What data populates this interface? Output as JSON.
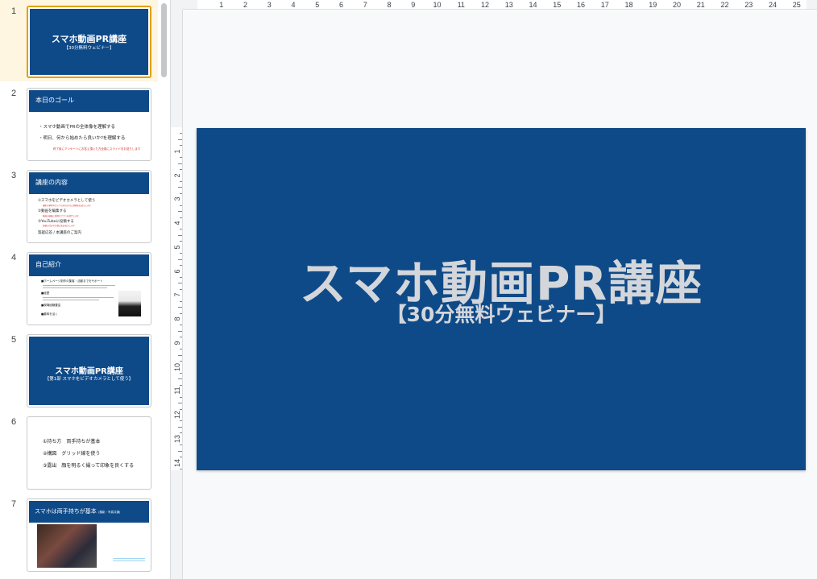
{
  "filmstrip": {
    "slides": [
      {
        "num": "1",
        "title": "スマホ動画PR講座",
        "subtitle": "【30分無料ウェビナー】"
      },
      {
        "num": "2",
        "header": "本日のゴール",
        "lines": [
          "・スマホ動画でPRの全体像を理解する",
          "・明日、何から始めたら良いか?を理解する"
        ],
        "note": "終了後にアンケートにお答え頂いた方全員にスライドをお送りします"
      },
      {
        "num": "3",
        "header": "講座の内容",
        "lines": [
          "①スマホをビデオカメラとして使う",
          "②動画を編集する",
          "③YouTubeに投稿する",
          "質疑応答 / 本講座のご案内"
        ],
        "notes": [
          "撮影の基本やカメラの持ち方など基礎をお伝えします",
          "動画の編集に便利なアプリを紹介します",
          "投稿の仕方や注意点をお伝えします"
        ]
      },
      {
        "num": "4",
        "header": "自己紹介",
        "lines": [
          "■ホームページ制作の集客・活動までをサポート",
          "■経歴",
          "■現場経験豊富",
          "■趣味を活く"
        ]
      },
      {
        "num": "5",
        "title": "スマホ動画PR講座",
        "subtitle": "【第1部 スマホをビデオカメラとして使う】"
      },
      {
        "num": "6",
        "lines": [
          "①持ち方　両手持ちが基本",
          "②構図　グリッド線を使う",
          "③露出　顔を明るく撮って印象を良くする"
        ]
      },
      {
        "num": "7",
        "header": "スマホは両手持ちが基本",
        "header_small": "(撮影・写真共通)"
      }
    ]
  },
  "ruler": {
    "horizontal": [
      "1",
      "2",
      "3",
      "4",
      "5",
      "6",
      "7",
      "8",
      "9",
      "10",
      "11",
      "12",
      "13",
      "14",
      "15",
      "16",
      "17",
      "18",
      "19",
      "20",
      "21",
      "22",
      "23",
      "24",
      "25"
    ],
    "vertical": [
      "1",
      "2",
      "3",
      "4",
      "5",
      "6",
      "7",
      "8",
      "9",
      "10",
      "11",
      "12",
      "13",
      "14"
    ]
  },
  "slide": {
    "title": "スマホ動画PR講座",
    "subtitle": "【30分無料ウェビナー】",
    "background": "#0f4a88",
    "text_color": "#d3d6da"
  },
  "colors": {
    "selection": "#e0a100",
    "selected_row_bg": "#fef6e0",
    "canvas_bg": "#f8f9fa"
  }
}
